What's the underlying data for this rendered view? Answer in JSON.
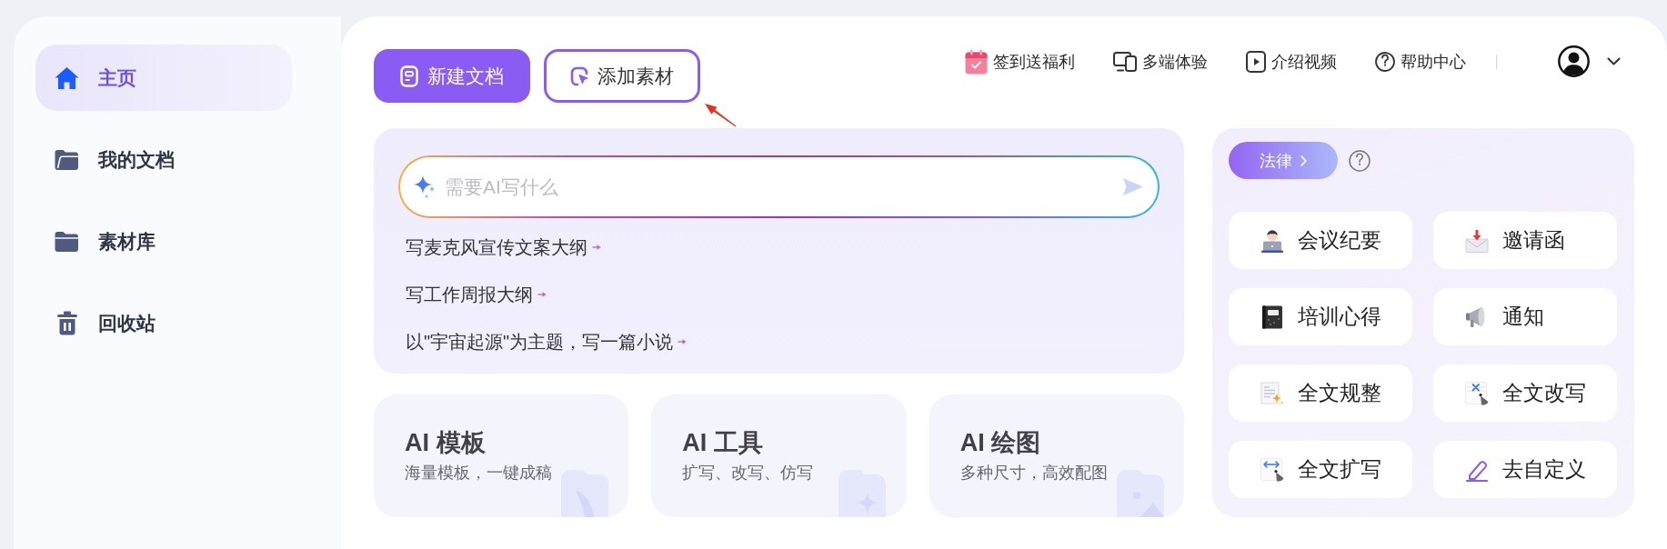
{
  "sidebar": {
    "items": [
      {
        "label": "主页",
        "selected": true
      },
      {
        "label": "我的文档",
        "selected": false
      },
      {
        "label": "素材库",
        "selected": false
      },
      {
        "label": "回收站",
        "selected": false
      }
    ]
  },
  "toolbar": {
    "buttons": [
      {
        "label": "新建文档",
        "kind": "primary"
      },
      {
        "label": "添加素材",
        "kind": "outline"
      }
    ]
  },
  "header": {
    "links": [
      "签到送福利",
      "多端体验",
      "介绍视频",
      "帮助中心"
    ]
  },
  "ai_prompt": {
    "placeholder": "需要AI写什么",
    "suggestions": [
      "写麦克风宣传文案大纲",
      "写工作周报大纲",
      "以\"宇宙起源\"为主题，写一篇小说"
    ]
  },
  "feature_cards": [
    {
      "title": "AI 模板",
      "subtitle": "海量模板，一键成稿"
    },
    {
      "title": "AI 工具",
      "subtitle": "扩写、改写、仿写"
    },
    {
      "title": "AI 绘图",
      "subtitle": "多种尺寸，高效配图"
    }
  ],
  "templates": {
    "category": "法律",
    "items": [
      "会议纪要",
      "邀请函",
      "培训心得",
      "通知",
      "全文规整",
      "全文改写",
      "全文扩写",
      "去自定义"
    ]
  }
}
